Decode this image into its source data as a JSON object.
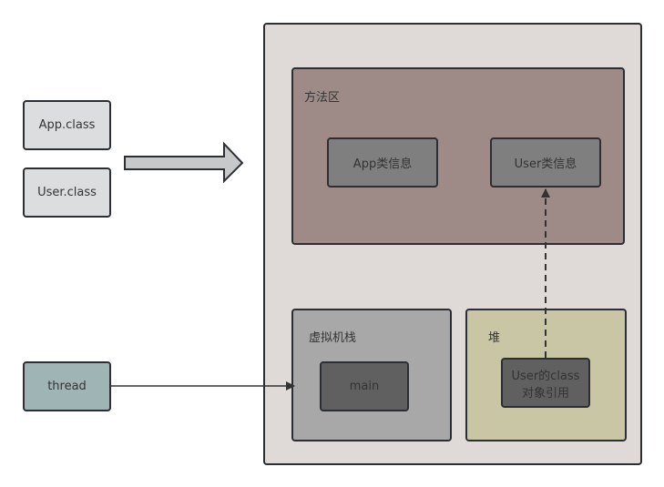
{
  "inputs": {
    "app_class": "App.class",
    "user_class": "User.class",
    "thread": "thread"
  },
  "jvm": {
    "method_area": {
      "title": "方法区",
      "app_info": "App类信息",
      "user_info": "User类信息"
    },
    "vm_stack": {
      "title": "虚拟机栈",
      "frame": "main"
    },
    "heap": {
      "title": "堆",
      "object_ref_line1": "User的class",
      "object_ref_line2": "对象引用"
    }
  },
  "colors": {
    "class_file_fill": "#dcdddf",
    "thread_fill": "#9fb4b4",
    "jvm_fill": "#dfdad7",
    "method_area_fill": "#9e8b87",
    "class_info_fill": "#7f7f7f",
    "vm_stack_fill": "#a8a8a8",
    "frame_fill": "#606060",
    "heap_fill": "#c8c6a4",
    "border": "#2b2f33"
  }
}
